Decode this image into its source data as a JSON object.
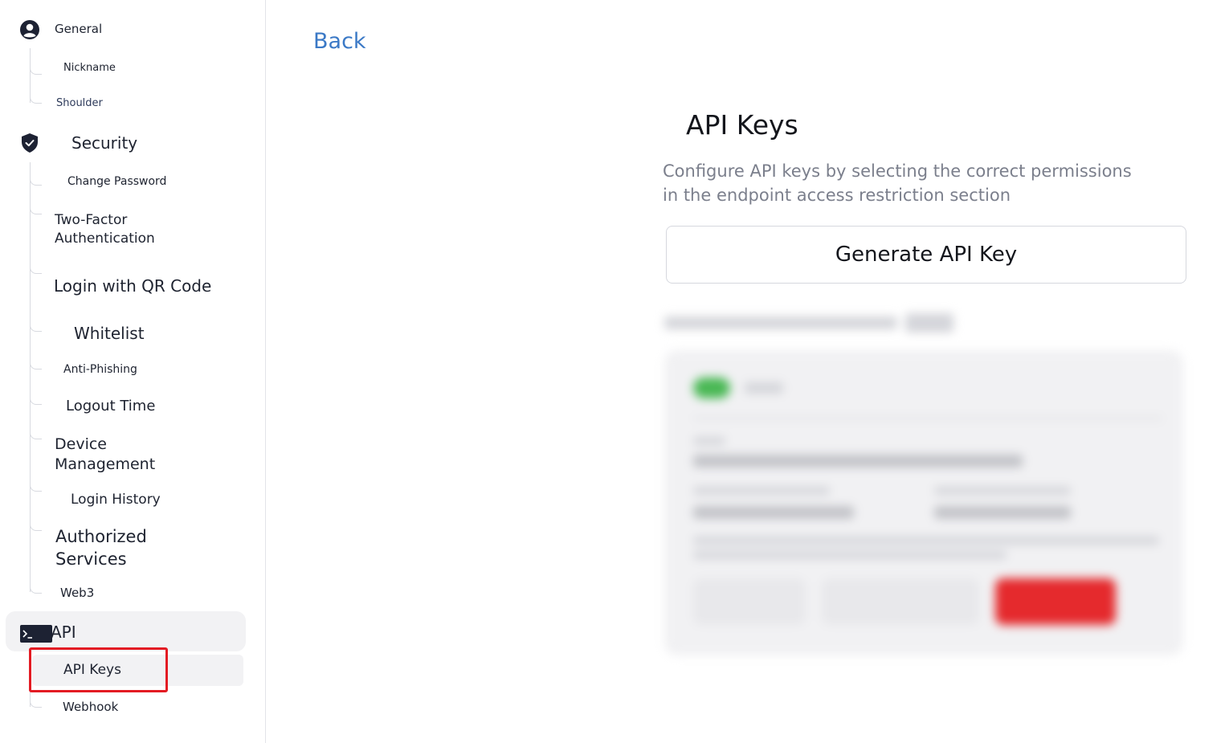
{
  "sidebar": {
    "general": {
      "label": "General",
      "items": [
        "Nickname",
        "Shoulder"
      ]
    },
    "security": {
      "label": "Security",
      "items": [
        "Change Password",
        "Two-Factor Authentication",
        "Login with QR Code",
        "Whitelist",
        "Anti-Phishing",
        "Logout Time",
        "Device Management",
        "Login History",
        "Authorized Services",
        "Web3"
      ]
    },
    "api": {
      "label": "API",
      "items": [
        "API Keys",
        "Webhook"
      ],
      "active_item": "API Keys"
    }
  },
  "main": {
    "back_label": "Back",
    "title": "API Keys",
    "description": "Configure API keys by selecting the correct permissions in the endpoint access restriction section",
    "generate_button_label": "Generate API Key"
  },
  "colors": {
    "link": "#3b79c6",
    "highlight": "#e31b23",
    "toggle_on": "#49b854",
    "danger": "#e52a2d"
  }
}
